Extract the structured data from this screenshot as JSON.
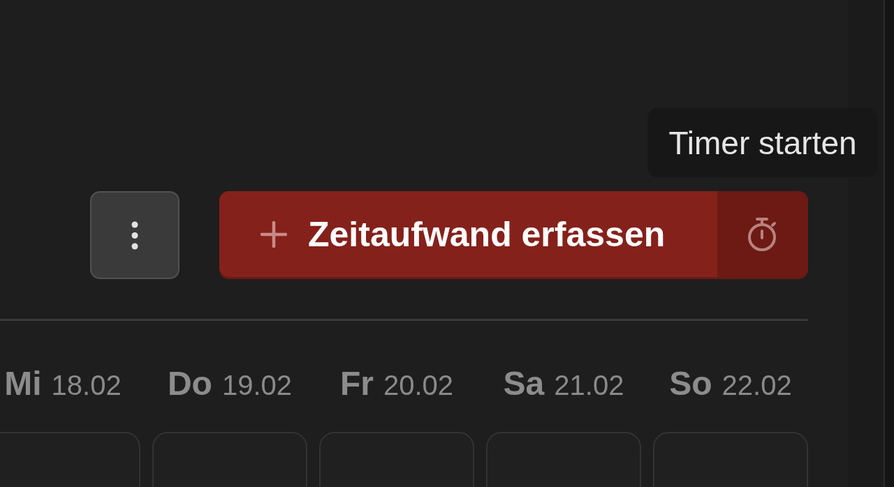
{
  "actions": {
    "primary_label": "Zeitaufwand erfassen",
    "timer_button": {
      "tooltip": "Timer starten"
    }
  },
  "days": [
    {
      "weekday": "Mi",
      "date": "18.02"
    },
    {
      "weekday": "Do",
      "date": "19.02"
    },
    {
      "weekday": "Fr",
      "date": "20.02"
    },
    {
      "weekday": "Sa",
      "date": "21.02"
    },
    {
      "weekday": "So",
      "date": "22.02"
    }
  ]
}
